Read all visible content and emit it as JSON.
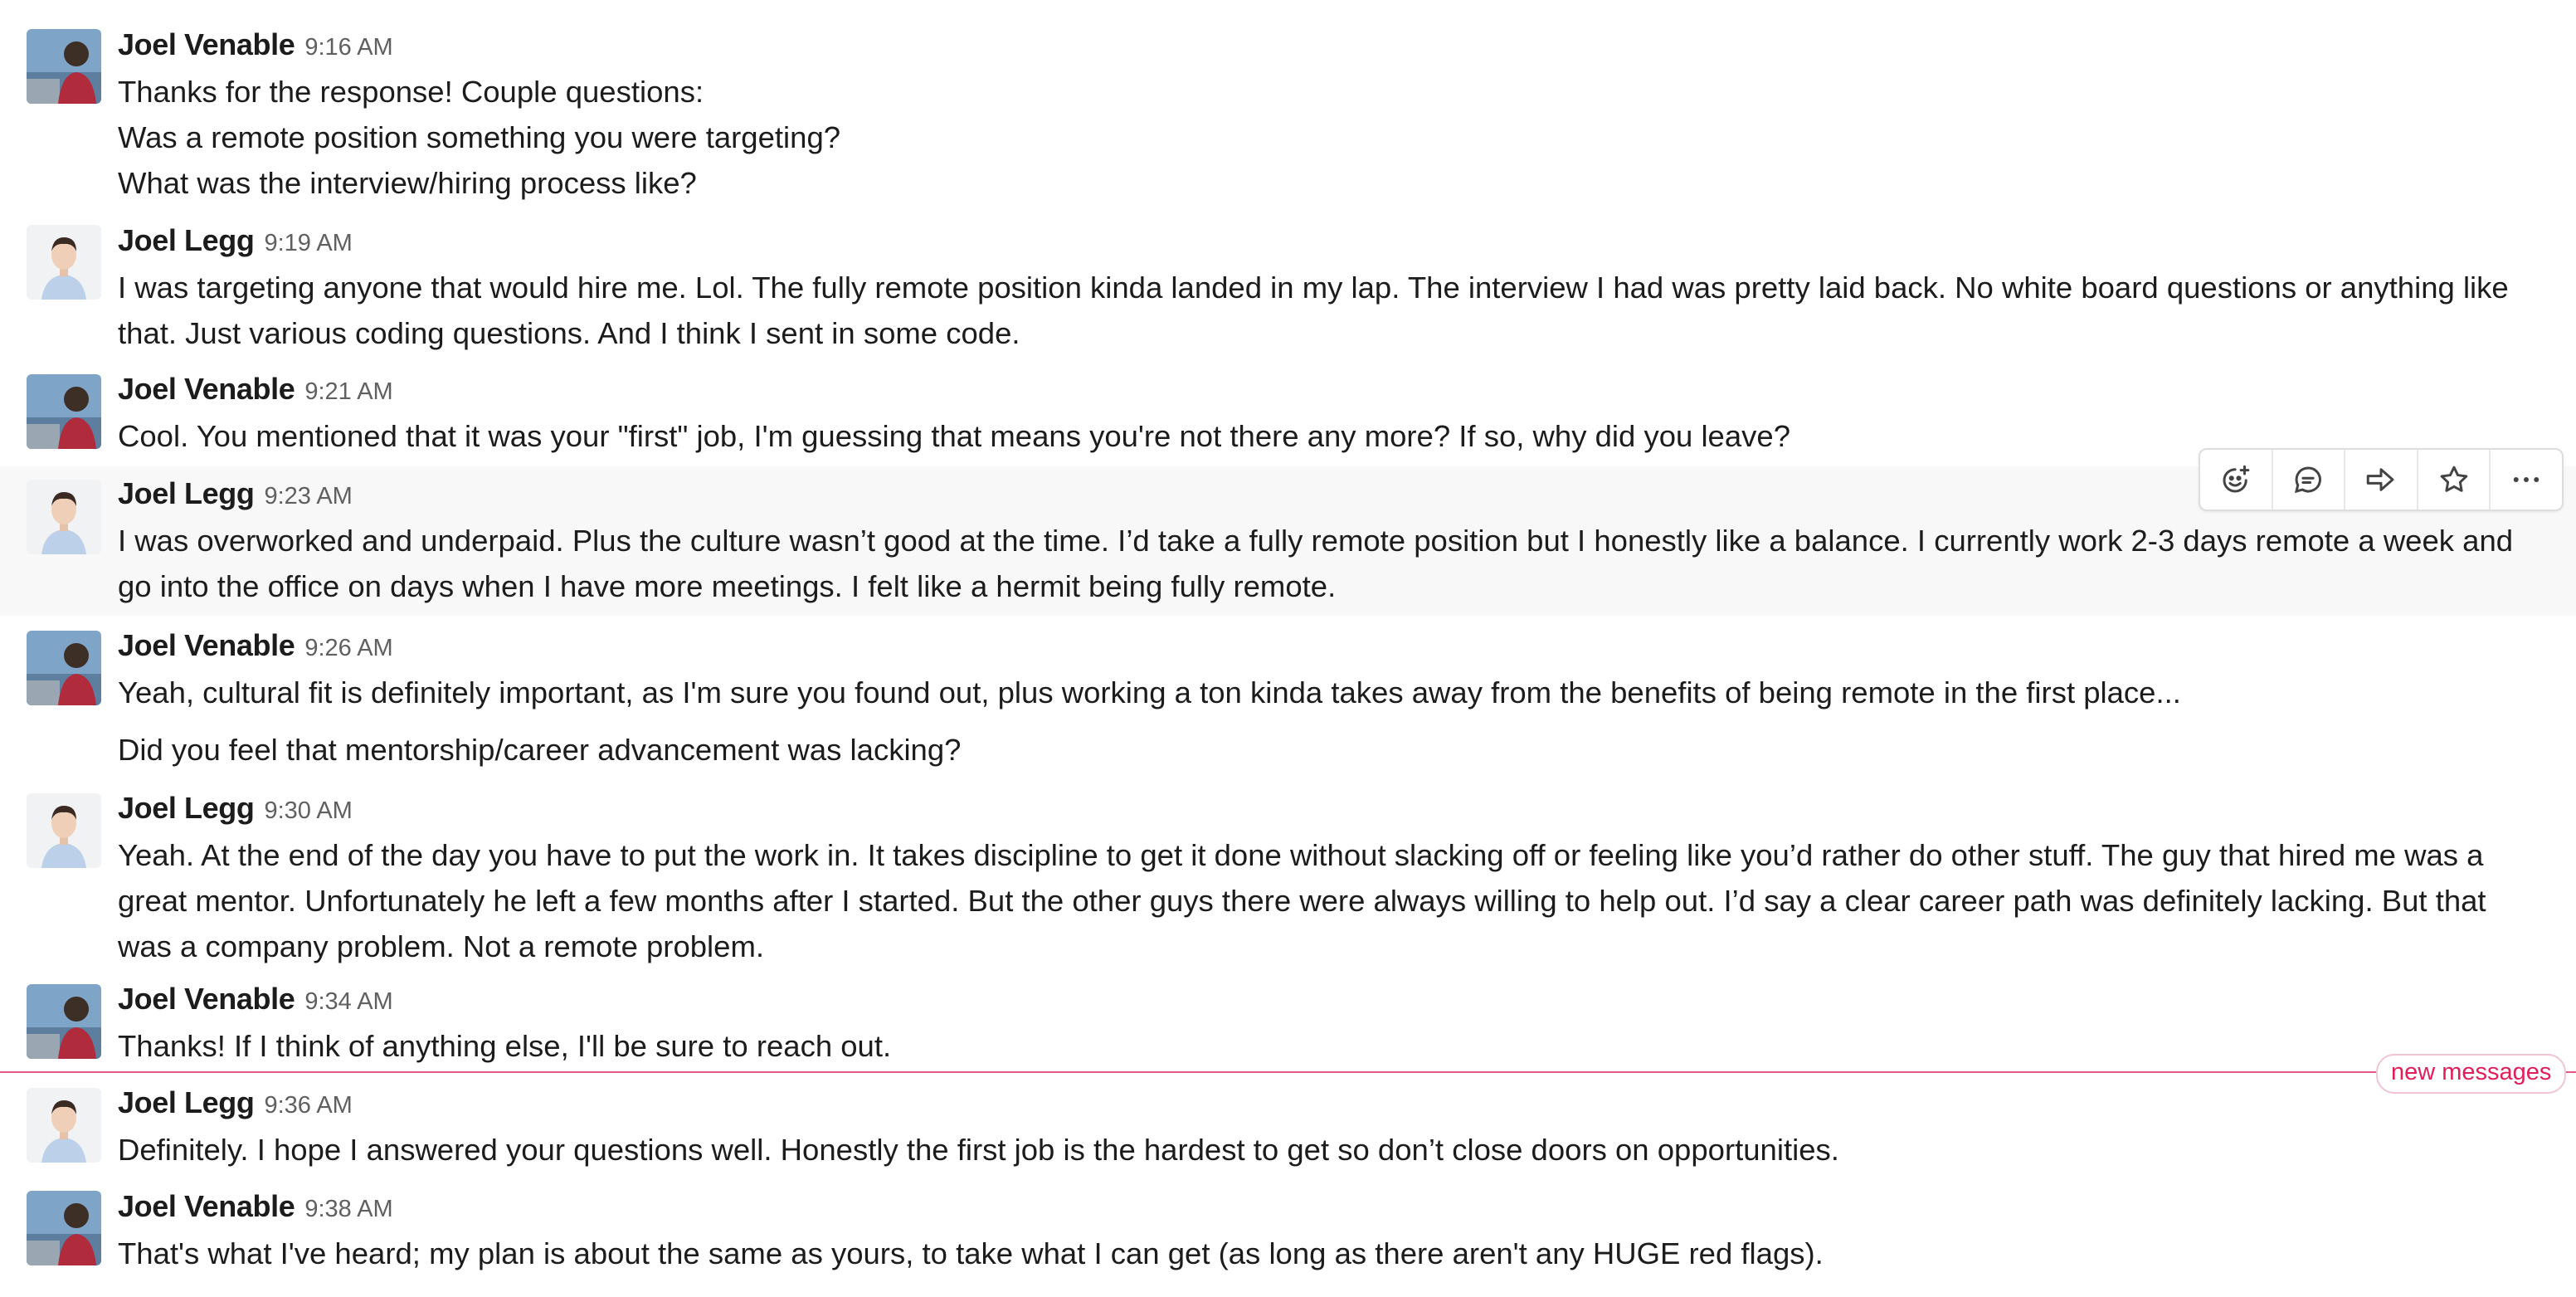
{
  "users": {
    "venable": {
      "name": "Joel Venable",
      "avatar_icon": "user-photo-venable-icon"
    },
    "legg": {
      "name": "Joel Legg",
      "avatar_icon": "user-photo-legg-icon"
    }
  },
  "messages": [
    {
      "author": "Joel Venable",
      "time": "9:16 AM",
      "lines": [
        "Thanks for the response!  Couple questions:",
        "Was a remote position something you were targeting?",
        "What was the interview/hiring process like?"
      ]
    },
    {
      "author": "Joel Legg",
      "time": "9:19 AM",
      "lines": [
        "I was targeting anyone that would hire me. Lol. The fully remote position kinda landed in my lap. The interview I had was pretty laid back. No white board questions or anything like",
        "that. Just various coding questions. And I think I sent in some code."
      ]
    },
    {
      "author": "Joel Venable",
      "time": "9:21 AM",
      "lines": [
        "Cool.  You mentioned that it was your \"first\" job, I'm guessing that means you're not there any more?   If so, why did you leave?"
      ]
    },
    {
      "author": "Joel Legg",
      "time": "9:23 AM",
      "lines": [
        "I was overworked and underpaid. Plus the culture wasn’t good at the time. I’d take a fully remote position but I honestly like a balance. I currently work 2-3 days remote a week and",
        "go into the office on days when I have more meetings. I felt like a hermit being fully remote."
      ]
    },
    {
      "author": "Joel Venable",
      "time": "9:26 AM",
      "lines": [
        "Yeah, cultural fit is definitely important, as I'm sure you found out, plus working a ton kinda takes away from the benefits of being remote in the first place...",
        "Did you feel that mentorship/career advancement was lacking?"
      ]
    },
    {
      "author": "Joel Legg",
      "time": "9:30 AM",
      "lines": [
        "Yeah. At the end of the day you have to put the work in. It takes discipline to get it done without slacking off or feeling like you’d rather do other stuff. The guy that hired me was a",
        "great mentor. Unfortunately he left a few months after I started. But the other guys there were always willing to help out. I’d say a clear career path was definitely lacking. But that",
        "was a company problem. Not a remote problem."
      ]
    },
    {
      "author": "Joel Venable",
      "time": "9:34 AM",
      "lines": [
        "Thanks!  If I think of anything else, I'll be sure to reach out."
      ]
    },
    {
      "author": "Joel Legg",
      "time": "9:36 AM",
      "lines": [
        "Definitely. I hope I answered your questions well. Honestly the first job is the hardest to get so don’t close doors on opportunities."
      ]
    },
    {
      "author": "Joel Venable",
      "time": "9:38 AM",
      "lines": [
        "That's what I've heard; my plan is about the same as yours, to take what I can get (as long as there aren't any HUGE red flags)."
      ]
    }
  ],
  "message_actions": [
    {
      "icon": "add-reaction-icon"
    },
    {
      "icon": "reply-in-thread-icon"
    },
    {
      "icon": "share-message-icon"
    },
    {
      "icon": "save-star-icon"
    },
    {
      "icon": "more-actions-icon"
    }
  ],
  "new_messages_label": "new messages",
  "colors": {
    "new_messages_accent": "#e01e5a",
    "hover_background": "#f8f8f8",
    "timestamp": "#616061",
    "text": "#1d1c1d"
  }
}
